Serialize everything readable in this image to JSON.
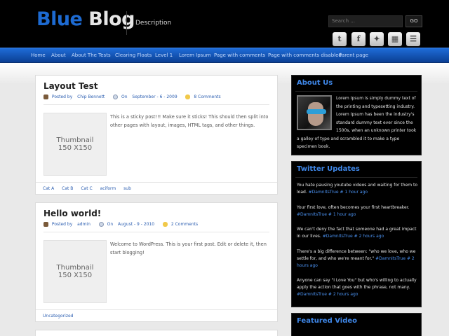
{
  "header": {
    "logo_first": "Blue",
    "logo_second": "Blog",
    "description": "Description",
    "search_placeholder": "Search ...",
    "search_button": "GO",
    "social": [
      {
        "icon": "twitter-icon",
        "glyph": "t"
      },
      {
        "icon": "facebook-icon",
        "glyph": "f"
      },
      {
        "icon": "delicious-icon",
        "glyph": "✦"
      },
      {
        "icon": "digg-icon",
        "glyph": "▦"
      },
      {
        "icon": "rss-icon",
        "glyph": "☰"
      }
    ]
  },
  "nav": {
    "items": [
      "Home",
      "About",
      "About The Tests",
      "Clearing Floats",
      "Level 1",
      "Lorem Ipsum",
      "Page with comments",
      "Page with comments disabled",
      "Parent page"
    ]
  },
  "posts": [
    {
      "title": "Layout Test",
      "author_prefix": "Posted by",
      "author": "Chip Bennett",
      "date_prefix": "On",
      "date": "September - 6 - 2009",
      "comments": "8 Comments",
      "thumb_line1": "Thumbnail",
      "thumb_line2": "150 X150",
      "excerpt": "This is a sticky post!!! Make sure it sticks! This should then split into other pages with layout, images, HTML tags, and other things.",
      "tags": [
        "Cat A",
        "Cat B",
        "Cat C",
        "aciform",
        "sub"
      ]
    },
    {
      "title": "Hello world!",
      "author_prefix": "Posted by",
      "author": "admin",
      "date_prefix": "On",
      "date": "August - 9 - 2010",
      "comments": "2 Comments",
      "thumb_line1": "Thumbnail",
      "thumb_line2": "150 X150",
      "excerpt": "Welcome to WordPress. This is your first post. Edit or delete it, then start blogging!",
      "tags": [
        "Uncategorized"
      ]
    }
  ],
  "sidebar": {
    "about": {
      "title": "About Us",
      "text": "Lorem Ipsum is simply dummy text of the printing and typesetting industry. Lorem Ipsum has been the industry's standard dummy text ever since the 1500s, when an unknown printer took a galley of type and scrambled it to make a type specimen book."
    },
    "twitter": {
      "title": "Twitter Updates",
      "tweets": [
        {
          "text": "You hate pausing youtube videos and waiting for them to load. ",
          "link": "#DamnItsTrue",
          "time": "# 1 hour ago"
        },
        {
          "text": "Your first love, often becomes your first heartbreaker. ",
          "link": "#DamnItsTrue",
          "time": "# 1 hour ago"
        },
        {
          "text": "We can't deny the fact that someone had a great impact in our lives. ",
          "link": "#DamnItsTrue",
          "time": "# 2 hours ago"
        },
        {
          "text": "There's a big difference between: \"who we love, who we settle for, and who we're meant for.\" ",
          "link": "#DamnItsTrue",
          "time": "# 2 hours ago"
        },
        {
          "text": "Anyone can say \"I Love You\" but who's willing to actually apply the action that goes with the phrase, not many. ",
          "link": "#DamnItsTrue",
          "time": "# 2 hours ago"
        }
      ]
    },
    "video": {
      "title": "Featured Video"
    }
  },
  "colors": {
    "accent": "#1d6ad1",
    "nav_top": "#1f6cd8",
    "nav_bottom": "#0b3f93",
    "link": "#2a5db0"
  }
}
